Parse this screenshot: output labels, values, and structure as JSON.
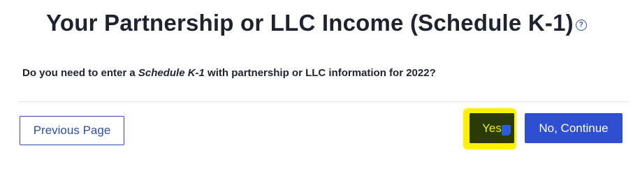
{
  "header": {
    "title": "Your Partnership or LLC Income (Schedule K-1)",
    "help_icon": "?"
  },
  "question": {
    "prefix": "Do you need to enter a ",
    "form_name": "Schedule K-1",
    "suffix": " with partnership or LLC information for 2022?"
  },
  "actions": {
    "previous_label": "Previous Page",
    "yes_label": "Yes",
    "continue_label": "No, Continue"
  },
  "colors": {
    "primary": "#2e4fd0",
    "highlight": "#fff200",
    "yes_button_bg": "#2a3a08",
    "text": "#1f2330"
  }
}
